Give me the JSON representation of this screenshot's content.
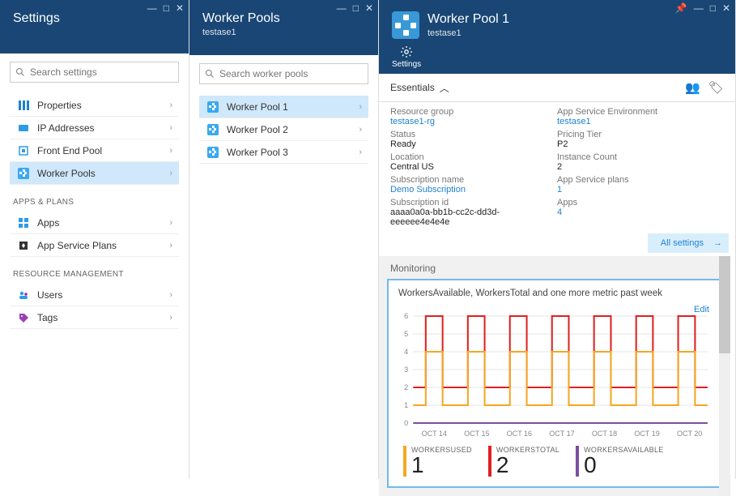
{
  "blade1": {
    "title": "Settings",
    "search_placeholder": "Search settings",
    "items": [
      {
        "label": "Properties",
        "icon": "properties"
      },
      {
        "label": "IP Addresses",
        "icon": "ip"
      },
      {
        "label": "Front End Pool",
        "icon": "frontend"
      },
      {
        "label": "Worker Pools",
        "icon": "worker",
        "selected": true
      }
    ],
    "section2_label": "APPS & PLANS",
    "items2": [
      {
        "label": "Apps",
        "icon": "apps"
      },
      {
        "label": "App Service Plans",
        "icon": "plans"
      }
    ],
    "section3_label": "RESOURCE MANAGEMENT",
    "items3": [
      {
        "label": "Users",
        "icon": "users"
      },
      {
        "label": "Tags",
        "icon": "tags"
      }
    ]
  },
  "blade2": {
    "title": "Worker Pools",
    "subtitle": "testase1",
    "search_placeholder": "Search worker pools",
    "items": [
      {
        "label": "Worker Pool 1",
        "selected": true
      },
      {
        "label": "Worker Pool 2"
      },
      {
        "label": "Worker Pool 3"
      }
    ]
  },
  "blade3": {
    "title": "Worker Pool 1",
    "subtitle": "testase1",
    "action_settings": "Settings",
    "essentials_label": "Essentials",
    "ess_left": [
      {
        "label": "Resource group",
        "value": "testase1-rg",
        "link": true
      },
      {
        "label": "Status",
        "value": "Ready"
      },
      {
        "label": "Location",
        "value": "Central US"
      },
      {
        "label": "Subscription name",
        "value": "Demo Subscription",
        "link": true
      },
      {
        "label": "Subscription id",
        "value": "aaaa0a0a-bb1b-cc2c-dd3d-eeeeee4e4e4e"
      }
    ],
    "ess_right": [
      {
        "label": "App Service Environment",
        "value": "testase1",
        "link": true
      },
      {
        "label": "Pricing Tier",
        "value": "P2"
      },
      {
        "label": "Instance Count",
        "value": "2"
      },
      {
        "label": "App Service plans",
        "value": "1",
        "link": true
      },
      {
        "label": "Apps",
        "value": "4",
        "link": true
      }
    ],
    "all_settings": "All settings",
    "monitoring_label": "Monitoring",
    "chart_title": "WorkersAvailable, WorkersTotal and one more metric past week",
    "edit": "Edit",
    "metrics": [
      {
        "label": "WORKERSUSED",
        "value": "1",
        "cls": "m-orange"
      },
      {
        "label": "WORKERSTOTAL",
        "value": "2",
        "cls": "m-red"
      },
      {
        "label": "WORKERSAVAILABLE",
        "value": "0",
        "cls": "m-purple"
      }
    ]
  },
  "chart_data": {
    "type": "line",
    "title": "WorkersAvailable, WorkersTotal and one more metric past week",
    "xlabel": "",
    "ylabel": "",
    "ylim": [
      0,
      6
    ],
    "yticks": [
      0,
      1,
      2,
      3,
      4,
      5,
      6
    ],
    "categories": [
      "OCT 14",
      "OCT 15",
      "OCT 16",
      "OCT 17",
      "OCT 18",
      "OCT 19",
      "OCT 20"
    ],
    "pattern_note": "Each day has a spike: red goes 2→6→2, orange goes 1→4→1; spike occupies roughly middle third of day.",
    "series": [
      {
        "name": "WorkersTotal",
        "color": "#e02020",
        "day_values": {
          "baseline": 2,
          "peak": 6
        }
      },
      {
        "name": "WorkersUsed",
        "color": "#f5a623",
        "day_values": {
          "baseline": 1,
          "peak": 4
        }
      },
      {
        "name": "WorkersAvailable",
        "color": "#7b4fa0",
        "day_values": {
          "baseline": 0,
          "peak": 0
        }
      }
    ]
  }
}
